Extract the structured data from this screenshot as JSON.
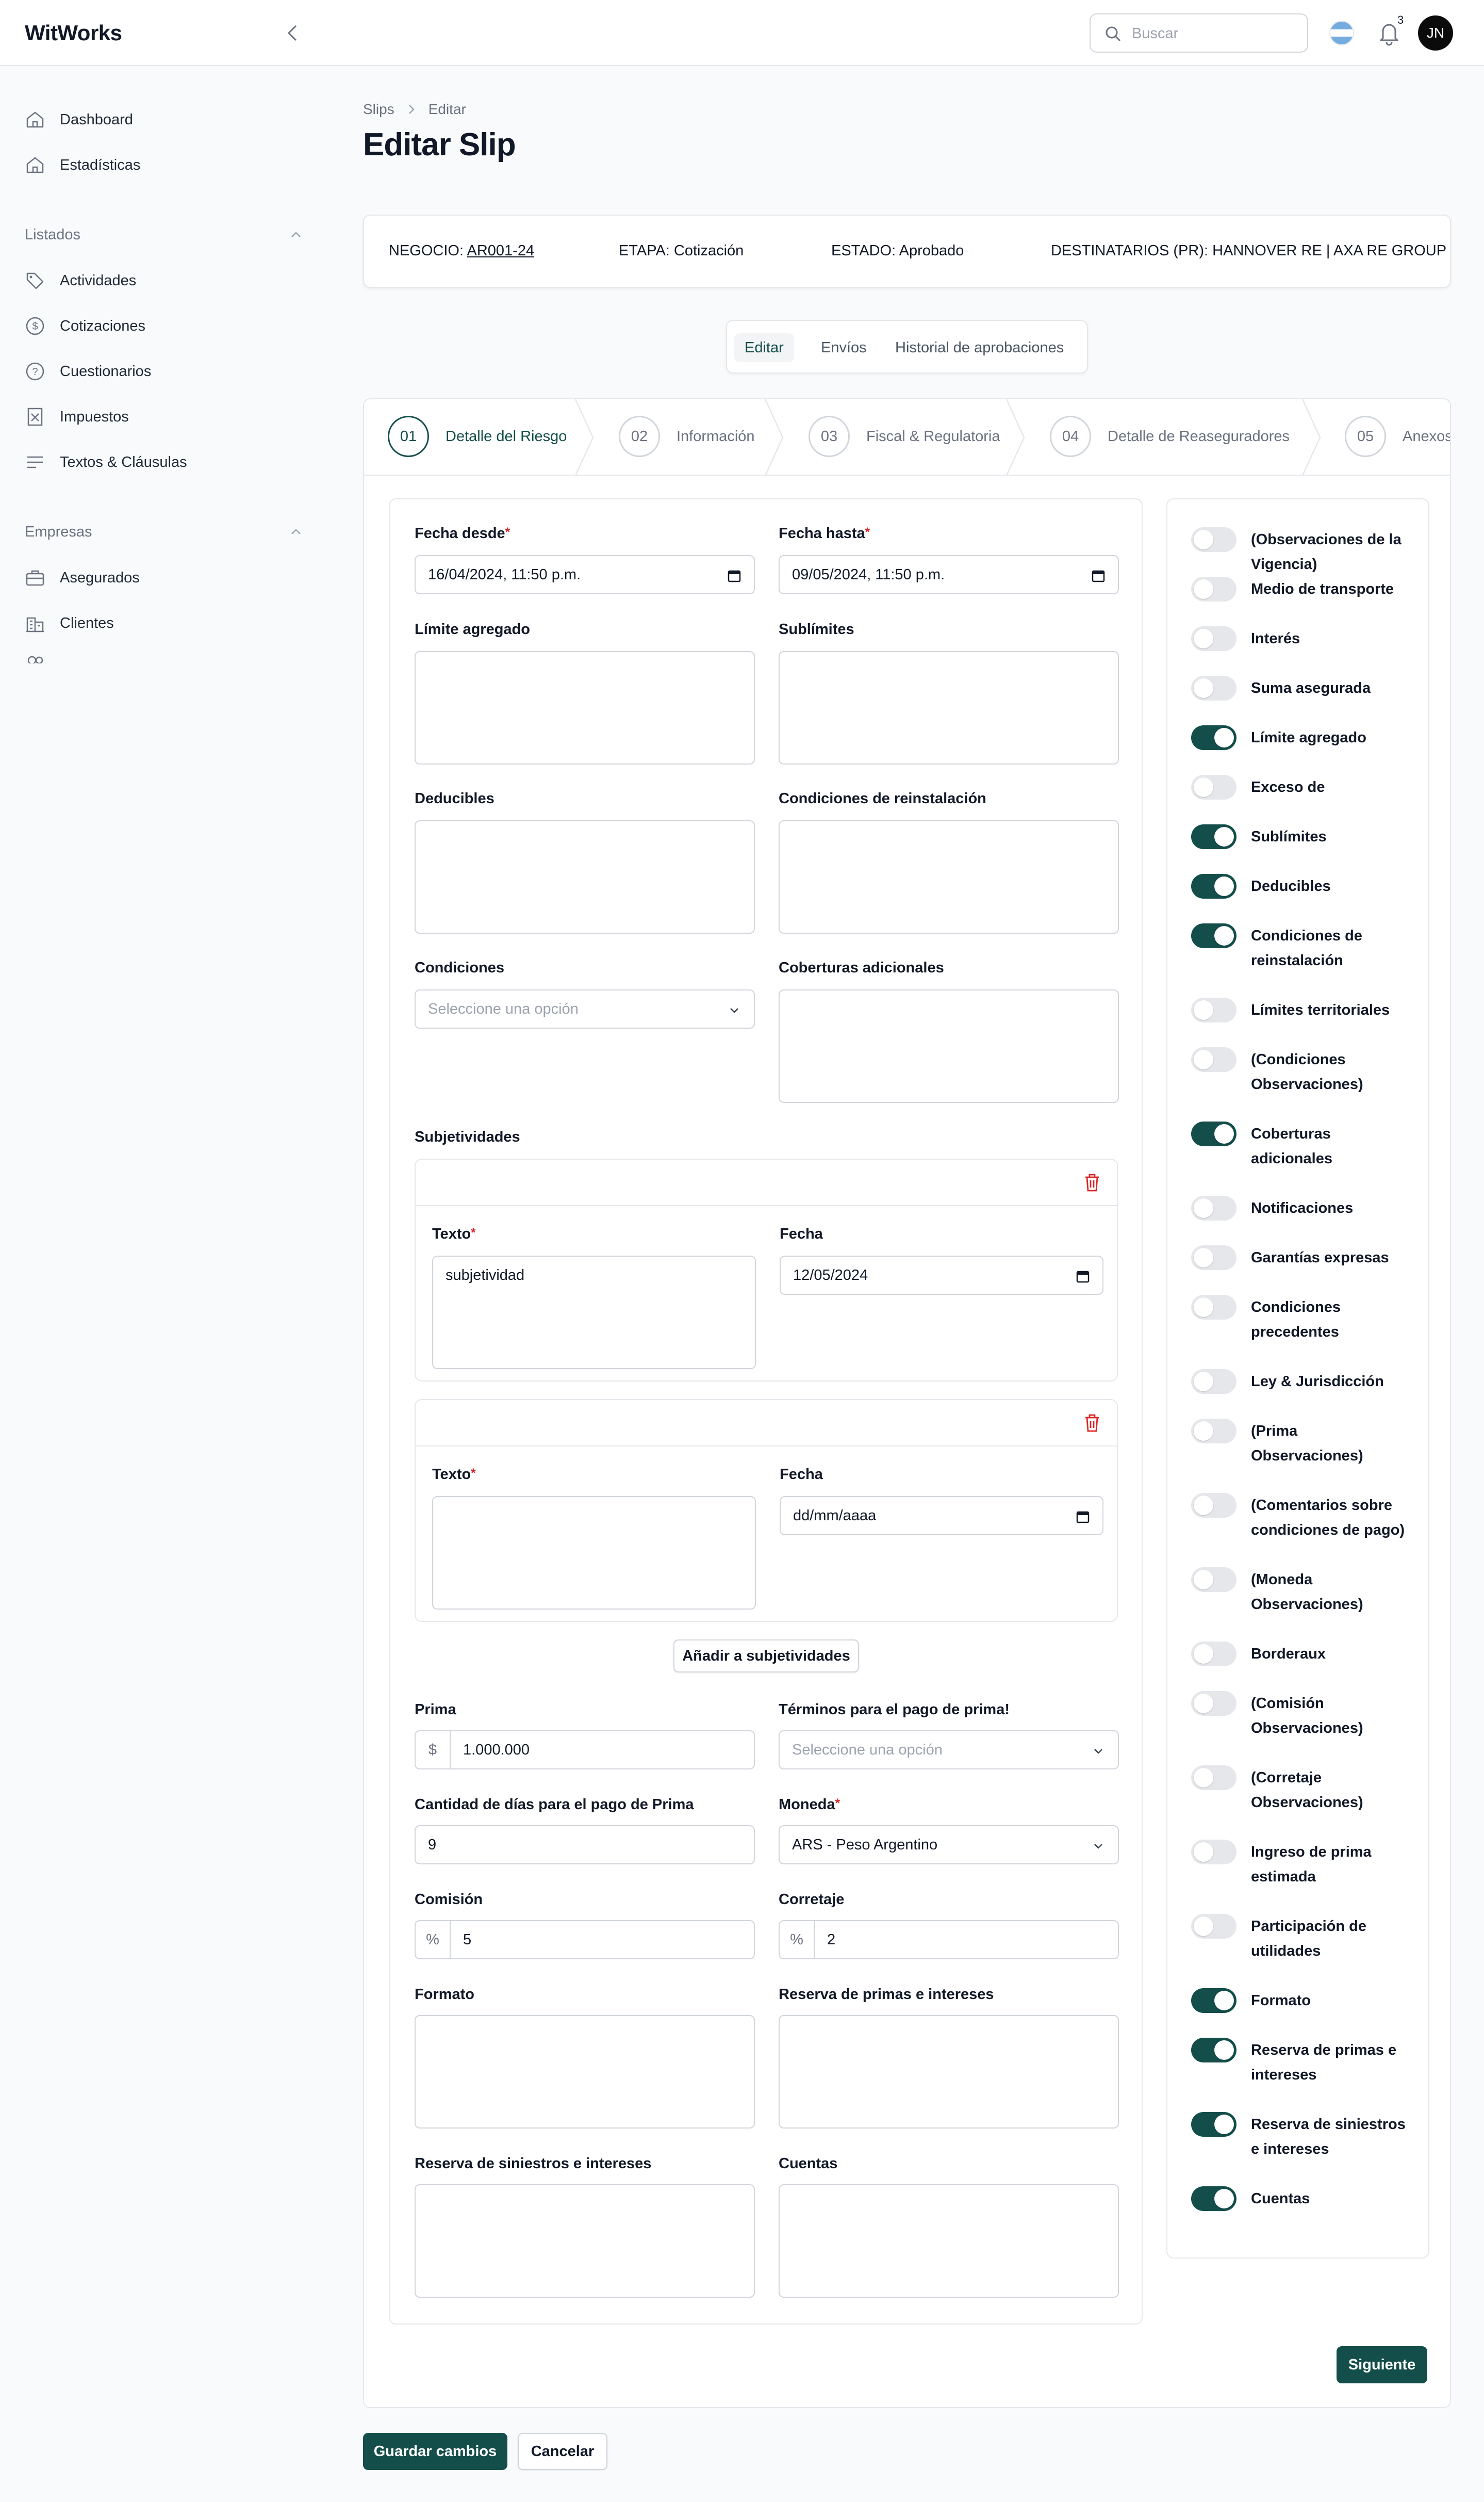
{
  "app": {
    "brand": "WitWorks"
  },
  "header": {
    "search_placeholder": "Buscar",
    "notification_count": "3",
    "user_initials": "JN"
  },
  "sidebar": {
    "top_items": [
      {
        "label": "Dashboard"
      },
      {
        "label": "Estadísticas"
      }
    ],
    "sections": [
      {
        "title": "Listados",
        "items": [
          {
            "label": "Actividades"
          },
          {
            "label": "Cotizaciones"
          },
          {
            "label": "Cuestionarios"
          },
          {
            "label": "Impuestos"
          },
          {
            "label": "Textos & Cláusulas"
          }
        ]
      },
      {
        "title": "Empresas",
        "items": [
          {
            "label": "Asegurados"
          },
          {
            "label": "Clientes"
          }
        ]
      }
    ]
  },
  "breadcrumb": {
    "items": [
      "Slips",
      "Editar"
    ]
  },
  "page": {
    "title": "Editar Slip"
  },
  "info": {
    "negocio_label": "NEGOCIO:",
    "negocio_value": "AR001-24",
    "etapa_label": "ETAPA:",
    "etapa_value": "Cotización",
    "estado_label": "ESTADO:",
    "estado_value": "Aprobado",
    "destinatarios_label": "DESTINATARIOS (PR):",
    "destinatarios_value": "HANNOVER RE | AXA RE GROUP"
  },
  "tabs": [
    {
      "label": "Editar",
      "active": true
    },
    {
      "label": "Envíos"
    },
    {
      "label": "Historial de aprobaciones"
    }
  ],
  "steps": [
    {
      "number": "01",
      "label": "Detalle del Riesgo",
      "active": true
    },
    {
      "number": "02",
      "label": "Información"
    },
    {
      "number": "03",
      "label": "Fiscal & Regulatoria"
    },
    {
      "number": "04",
      "label": "Detalle de Reaseguradores"
    },
    {
      "number": "05",
      "label": "Anexos"
    }
  ],
  "form": {
    "fecha_desde": {
      "label": "Fecha desde",
      "value": "16/04/2024, 11:50 p.m."
    },
    "fecha_hasta": {
      "label": "Fecha hasta",
      "value": "09/05/2024, 11:50 p.m."
    },
    "limite_agregado": {
      "label": "Límite agregado"
    },
    "sublimites": {
      "label": "Sublímites"
    },
    "deducibles": {
      "label": "Deducibles"
    },
    "condiciones_reinstalacion": {
      "label": "Condiciones de reinstalación"
    },
    "condiciones": {
      "label": "Condiciones",
      "placeholder": "Seleccione una opción"
    },
    "coberturas_adicionales": {
      "label": "Coberturas adicionales"
    },
    "subjetividades": {
      "label": "Subjetividades",
      "items": [
        {
          "texto_label": "Texto",
          "texto_value": "subjetividad",
          "fecha_label": "Fecha",
          "fecha_value": "12/05/2024"
        },
        {
          "texto_label": "Texto",
          "texto_value": "",
          "fecha_label": "Fecha",
          "fecha_value": "dd/mm/aaaa"
        }
      ],
      "add_button": "Añadir a subjetividades"
    },
    "prima": {
      "label": "Prima",
      "prefix": "$",
      "value": "1.000.000"
    },
    "terminos_pago": {
      "label": "Términos para el pago de prima!",
      "placeholder": "Seleccione una opción"
    },
    "dias_pago": {
      "label": "Cantidad de días para el pago de Prima",
      "value": "9"
    },
    "moneda": {
      "label": "Moneda",
      "value": "ARS - Peso Argentino"
    },
    "comision": {
      "label": "Comisión",
      "prefix": "%",
      "value": "5"
    },
    "corretaje": {
      "label": "Corretaje",
      "prefix": "%",
      "value": "2"
    },
    "formato": {
      "label": "Formato"
    },
    "reserva_primas": {
      "label": "Reserva de primas e intereses"
    },
    "reserva_siniestros": {
      "label": "Reserva de siniestros e intereses"
    },
    "cuentas": {
      "label": "Cuentas"
    }
  },
  "toggles": [
    {
      "label": "(Observaciones de la Vigencia)",
      "on": false
    },
    {
      "label": "Medio de transporte",
      "on": false
    },
    {
      "label": "Interés",
      "on": false
    },
    {
      "label": "Suma asegurada",
      "on": false
    },
    {
      "label": "Límite agregado",
      "on": true
    },
    {
      "label": "Exceso de",
      "on": false
    },
    {
      "label": "Sublímites",
      "on": true
    },
    {
      "label": "Deducibles",
      "on": true
    },
    {
      "label": "Condiciones de reinstalación",
      "on": true
    },
    {
      "label": "Límites territoriales",
      "on": false
    },
    {
      "label": "(Condiciones Observaciones)",
      "on": false
    },
    {
      "label": "Coberturas adicionales",
      "on": true
    },
    {
      "label": "Notificaciones",
      "on": false
    },
    {
      "label": "Garantías expresas",
      "on": false
    },
    {
      "label": "Condiciones precedentes",
      "on": false
    },
    {
      "label": "Ley & Jurisdicción",
      "on": false
    },
    {
      "label": "(Prima Observaciones)",
      "on": false
    },
    {
      "label": "(Comentarios sobre condiciones de pago)",
      "on": false
    },
    {
      "label": "(Moneda Observaciones)",
      "on": false
    },
    {
      "label": "Borderaux",
      "on": false
    },
    {
      "label": "(Comisión Observaciones)",
      "on": false
    },
    {
      "label": "(Corretaje Observaciones)",
      "on": false
    },
    {
      "label": "Ingreso de prima estimada",
      "on": false
    },
    {
      "label": "Participación de utilidades",
      "on": false
    },
    {
      "label": "Formato",
      "on": true
    },
    {
      "label": "Reserva de primas e intereses",
      "on": true
    },
    {
      "label": "Reserva de siniestros e intereses",
      "on": true
    },
    {
      "label": "Cuentas",
      "on": true
    }
  ],
  "actions": {
    "next": "Siguiente",
    "save": "Guardar cambios",
    "cancel": "Cancelar"
  },
  "colors": {
    "accent": "#134e4a",
    "danger": "#dc2626",
    "border": "#e5e7eb"
  }
}
